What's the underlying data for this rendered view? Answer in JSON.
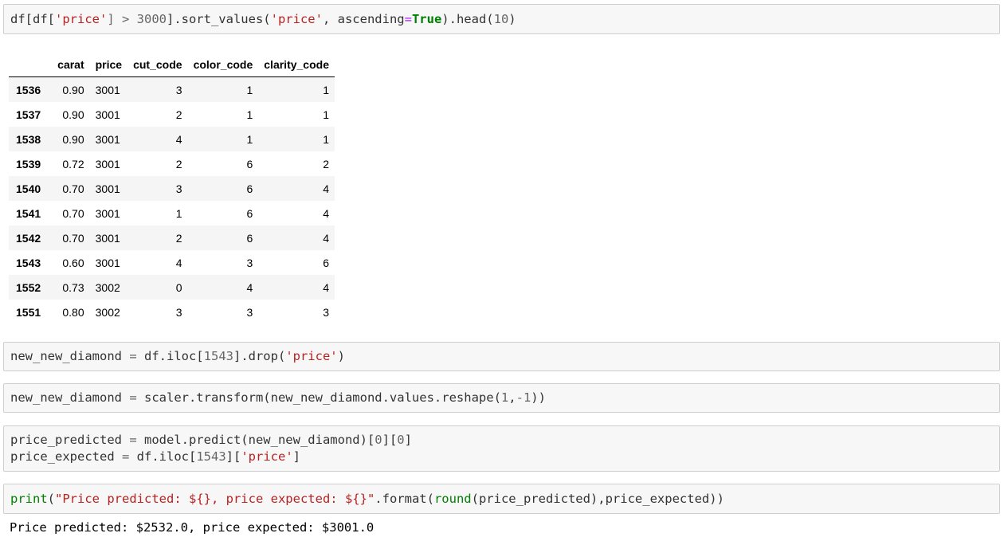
{
  "cell1": {
    "parts": [
      "df[df[",
      "'price'",
      "] > ",
      "3000",
      "].sort_values(",
      "'price'",
      ", ascending",
      "=",
      "True",
      ").head(",
      "10",
      ")"
    ]
  },
  "table": {
    "columns": [
      "",
      "carat",
      "price",
      "cut_code",
      "color_code",
      "clarity_code"
    ],
    "rows": [
      {
        "index": "1536",
        "carat": "0.90",
        "price": "3001",
        "cut_code": "3",
        "color_code": "1",
        "clarity_code": "1"
      },
      {
        "index": "1537",
        "carat": "0.90",
        "price": "3001",
        "cut_code": "2",
        "color_code": "1",
        "clarity_code": "1"
      },
      {
        "index": "1538",
        "carat": "0.90",
        "price": "3001",
        "cut_code": "4",
        "color_code": "1",
        "clarity_code": "1"
      },
      {
        "index": "1539",
        "carat": "0.72",
        "price": "3001",
        "cut_code": "2",
        "color_code": "6",
        "clarity_code": "2"
      },
      {
        "index": "1540",
        "carat": "0.70",
        "price": "3001",
        "cut_code": "3",
        "color_code": "6",
        "clarity_code": "4"
      },
      {
        "index": "1541",
        "carat": "0.70",
        "price": "3001",
        "cut_code": "1",
        "color_code": "6",
        "clarity_code": "4"
      },
      {
        "index": "1542",
        "carat": "0.70",
        "price": "3001",
        "cut_code": "2",
        "color_code": "6",
        "clarity_code": "4"
      },
      {
        "index": "1543",
        "carat": "0.60",
        "price": "3001",
        "cut_code": "4",
        "color_code": "3",
        "clarity_code": "6"
      },
      {
        "index": "1552",
        "carat": "0.73",
        "price": "3002",
        "cut_code": "0",
        "color_code": "4",
        "clarity_code": "4"
      },
      {
        "index": "1551",
        "carat": "0.80",
        "price": "3002",
        "cut_code": "3",
        "color_code": "3",
        "clarity_code": "3"
      }
    ]
  },
  "cell2": {
    "parts": [
      "new_new_diamond ",
      "=",
      " df.iloc[",
      "1543",
      "].drop(",
      "'price'",
      ")"
    ]
  },
  "cell3": {
    "parts": [
      "new_new_diamond ",
      "=",
      " scaler.transform(new_new_diamond.values.reshape(",
      "1",
      ",",
      "-1",
      "))"
    ]
  },
  "cell4": {
    "line1": [
      "price_predicted ",
      "=",
      " model.predict(new_new_diamond)[",
      "0",
      "][",
      "0",
      "]"
    ],
    "line2": [
      "price_expected ",
      "=",
      " df.iloc[",
      "1543",
      "][",
      "'price'",
      "]"
    ]
  },
  "cell5": {
    "parts": [
      "print",
      "(",
      "\"Price predicted: ${}, price expected: ${}\"",
      ".format(",
      "round",
      "(price_predicted),price_expected))"
    ]
  },
  "output": {
    "text": "Price predicted: $2532.0, price expected: $3001.0"
  }
}
